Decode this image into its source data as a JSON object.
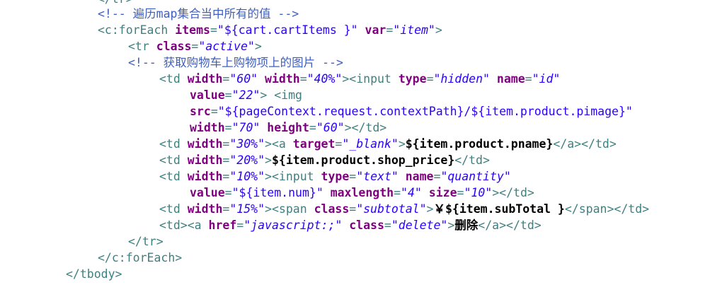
{
  "code": {
    "line0": "</tr>",
    "line1": "<!-- 遍历map集合当中所有的值 -->",
    "line2": {
      "open": "<c:forEach",
      "items_attr": "items",
      "items_eq": "=",
      "items_val": "\"${cart.cartItems }\"",
      "var_attr": "var",
      "var_eq": "=",
      "var_val": "\"item\"",
      "close": ">"
    },
    "line3": {
      "open": "<tr",
      "class_attr": "class",
      "eq": "=",
      "class_val": "\"active\"",
      "close": ">"
    },
    "line4": "<!-- 获取购物车上购物项上的图片 -->",
    "line5": {
      "open": "<td",
      "w1_attr": "width",
      "eq": "=",
      "w1_val": "\"60\"",
      "w2_attr": "width",
      "w2_val": "\"40%\"",
      "close": ">",
      "input_open": "<input",
      "type_attr": "type",
      "type_val": "\"hidden\"",
      "name_attr": "name",
      "name_val": "\"id\""
    },
    "line6": {
      "value_attr": "value",
      "eq": "=",
      "value_val": "\"22\"",
      "close": ">",
      "img_open": "<img"
    },
    "line7": {
      "src_attr": "src",
      "eq": "=",
      "src_val": "\"${pageContext.request.contextPath}/${item.product.pimage}\""
    },
    "line8": {
      "w_attr": "width",
      "eq": "=",
      "w_val": "\"70\"",
      "h_attr": "height",
      "h_val": "\"60\"",
      "close": "></td>"
    },
    "line9": {
      "open": "<td",
      "w_attr": "width",
      "eq": "=",
      "w_val": "\"30%\"",
      "close": ">",
      "a_open": "<a",
      "target_attr": "target",
      "target_val": "\"_blank\"",
      "a_close": ">",
      "text": "${item.product.pname}",
      "end": "</a></td>"
    },
    "line10": {
      "open": "<td",
      "w_attr": "width",
      "eq": "=",
      "w_val": "\"20%\"",
      "close": ">",
      "text": "${item.product.shop_price}",
      "end": "</td>"
    },
    "line11": {
      "open": "<td",
      "w_attr": "width",
      "eq": "=",
      "w_val": "\"10%\"",
      "close": ">",
      "input_open": "<input",
      "type_attr": "type",
      "type_val": "\"text\"",
      "name_attr": "name",
      "name_val": "\"quantity\""
    },
    "line12": {
      "value_attr": "value",
      "eq": "=",
      "value_val": "\"${item.num}\"",
      "ml_attr": "maxlength",
      "ml_val": "\"4\"",
      "size_attr": "size",
      "size_val": "\"10\"",
      "end": "></td>"
    },
    "line13": {
      "open": "<td",
      "w_attr": "width",
      "eq": "=",
      "w_val": "\"15%\"",
      "close": ">",
      "span_open": "<span",
      "class_attr": "class",
      "class_val": "\"subtotal\"",
      "span_close": ">",
      "text": "￥${item.subTotal }",
      "end": "</span></td>"
    },
    "line14": {
      "open": "<td><a",
      "href_attr": "href",
      "eq": "=",
      "href_val": "\"javascript:;\"",
      "class_attr": "class",
      "class_val": "\"delete\"",
      "close": ">",
      "text": "删除",
      "end": "</a></td>"
    },
    "line15": "</tr>",
    "line16": "</c:forEach>",
    "line17": "</tbody>"
  }
}
